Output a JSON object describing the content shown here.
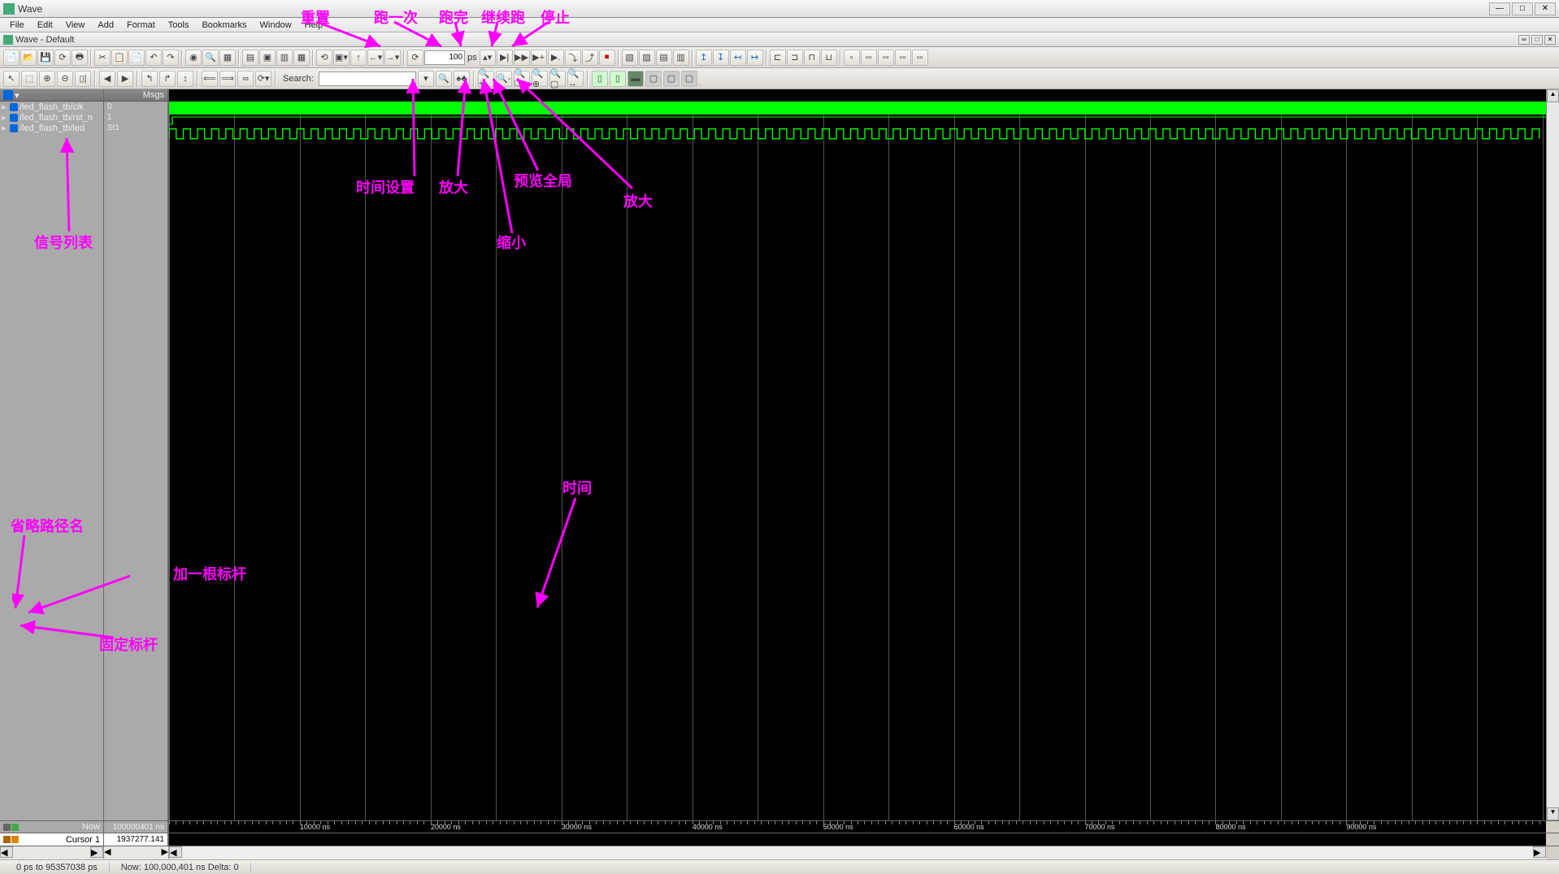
{
  "window": {
    "title": "Wave"
  },
  "subwindow": {
    "label": "Wave - Default"
  },
  "menus": [
    "File",
    "Edit",
    "View",
    "Add",
    "Format",
    "Tools",
    "Bookmarks",
    "Window",
    "Help"
  ],
  "toolbar1": {
    "run_time_value": "100",
    "run_time_unit": "ps"
  },
  "toolbar2": {
    "search_placeholder": "Search:",
    "search_value": ""
  },
  "panels": {
    "msgs_header": "Msgs"
  },
  "signals": [
    {
      "name": "/led_flash_tb/clk",
      "value": "0"
    },
    {
      "name": "/led_flash_tb/rst_n",
      "value": "1"
    },
    {
      "name": "/led_flash_tb/led",
      "value": "St1"
    }
  ],
  "bottom": {
    "now_label": "Now",
    "now_value": "100000401 ns",
    "cursor_label": "Cursor 1",
    "cursor_value": "1937277.141 ns"
  },
  "timeline_ticks": [
    {
      "label": "",
      "pos": 0
    },
    {
      "label": "10000 ns",
      "pos": 9.5
    },
    {
      "label": "20000 ns",
      "pos": 19
    },
    {
      "label": "30000 ns",
      "pos": 28.5
    },
    {
      "label": "40000 ns",
      "pos": 38
    },
    {
      "label": "50000 ns",
      "pos": 47.5
    },
    {
      "label": "60000 ns",
      "pos": 57
    },
    {
      "label": "70000 ns",
      "pos": 66.5
    },
    {
      "label": "80000 ns",
      "pos": 76
    },
    {
      "label": "90000 ns",
      "pos": 85.5
    }
  ],
  "status": {
    "range": "0 ps to 95357038 ps",
    "now": "Now: 100,000,401 ns  Delta: 0"
  },
  "annotations": {
    "reset": "重置",
    "run_once": "跑一次",
    "run_all": "跑完",
    "continue": "继续跑",
    "stop": "停止",
    "time_setting": "时间设置",
    "zoom_in": "放大",
    "zoom_full": "预览全局",
    "zoom_in2": "放大",
    "zoom_out": "缩小",
    "signal_list": "信号列表",
    "omit_path": "省略路径名",
    "add_cursor": "加一根标杆",
    "fix_cursor": "固定标杆",
    "time_label": "时间"
  }
}
